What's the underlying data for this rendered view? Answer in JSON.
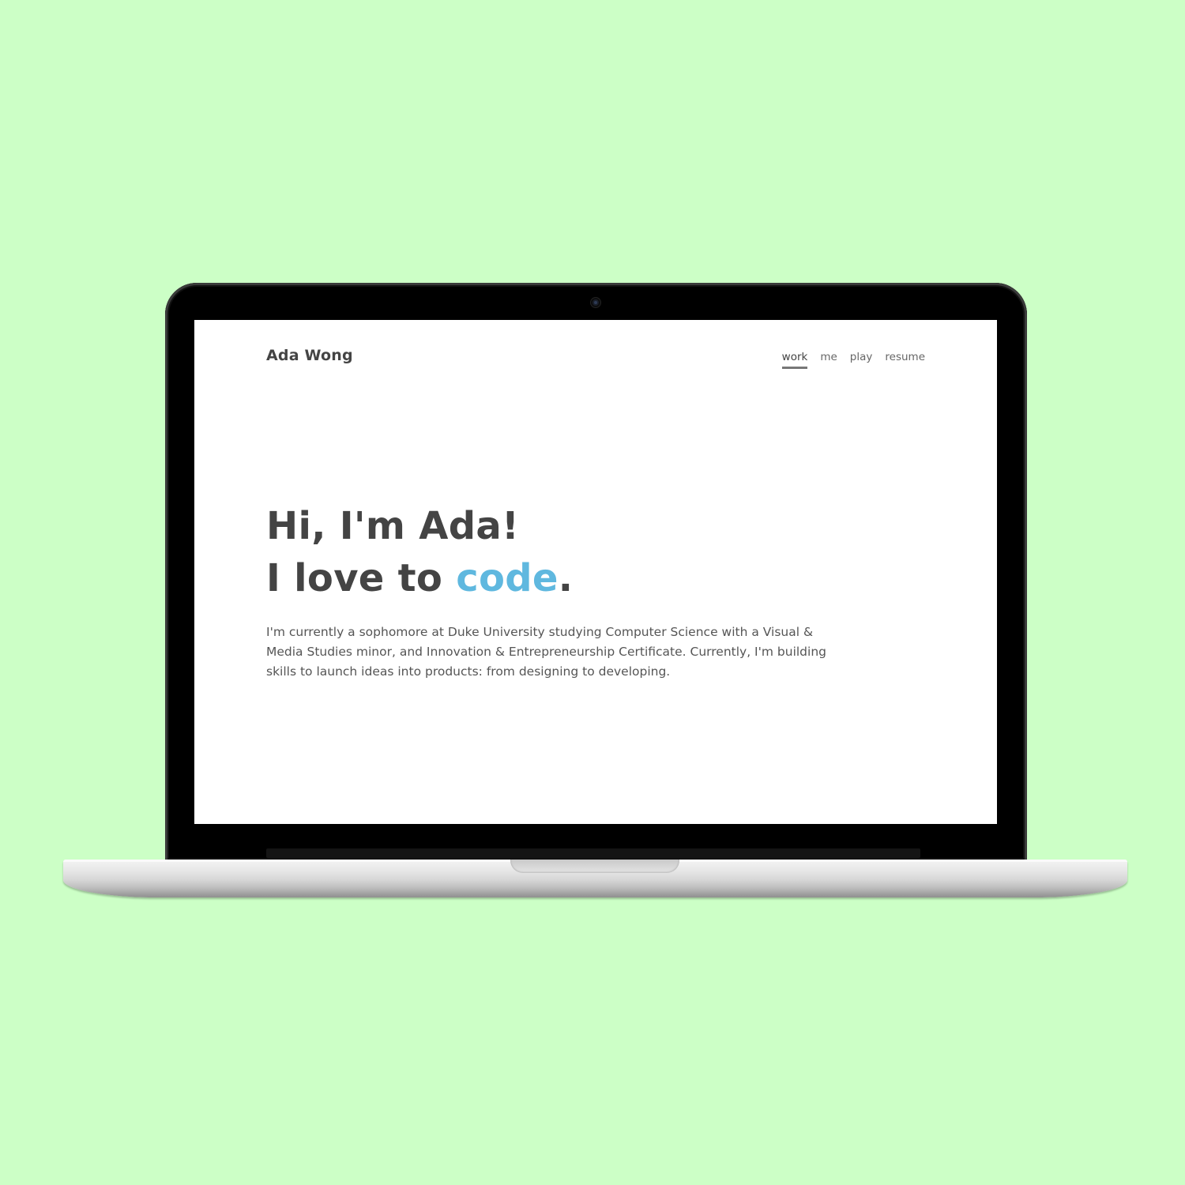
{
  "site": {
    "name": "Ada Wong"
  },
  "nav": {
    "items": [
      {
        "label": "work",
        "active": true
      },
      {
        "label": "me",
        "active": false
      },
      {
        "label": "play",
        "active": false
      },
      {
        "label": "resume",
        "active": false
      }
    ]
  },
  "hero": {
    "line1": "Hi, I'm Ada!",
    "line2_prefix": "I love to ",
    "line2_accent": "code",
    "line2_suffix": ".",
    "bio": "I'm currently a sophomore at Duke University studying Computer Science with a Visual & Media Studies minor, and Innovation & Entrepreneurship Certificate. Currently, I'm building skills to launch ideas into products: from designing to developing."
  },
  "colors": {
    "background": "#ccffc6",
    "accent": "#5fb8df",
    "text": "#444444"
  },
  "icons": {
    "camera": "webcam-icon"
  }
}
